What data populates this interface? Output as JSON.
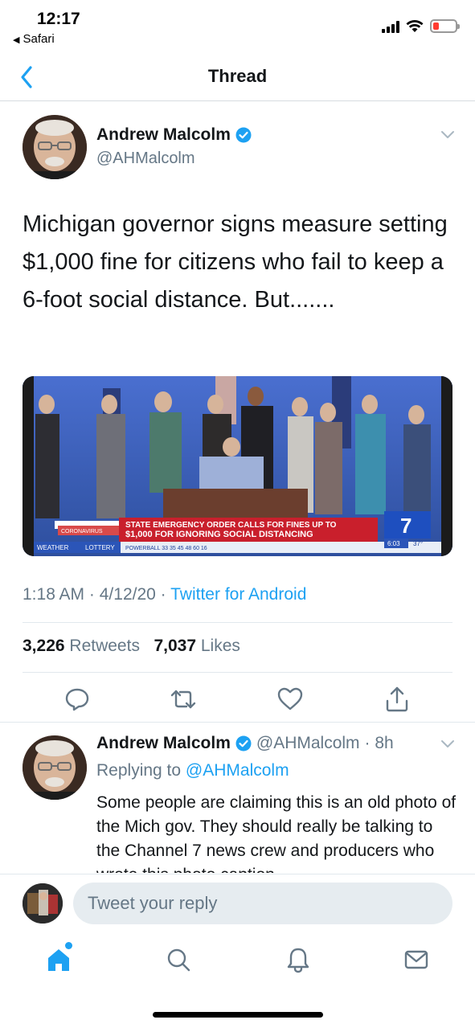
{
  "status_bar": {
    "time": "12:17",
    "back_app": "Safari"
  },
  "nav": {
    "title": "Thread",
    "back_icon": "chevron-left-icon"
  },
  "main_tweet": {
    "author_name": "Andrew Malcolm",
    "author_handle": "@AHMalcolm",
    "verified": true,
    "text": "Michigan governor signs measure setting $1,000 fine for citizens who fail to keep a 6-foot social distance. But.......",
    "media": {
      "banner_top": "STATE EMERGENCY ORDER CALLS FOR FINES UP TO",
      "banner_bottom": "$1,000 FOR IGNORING SOCIAL DISTANCING",
      "tag_left": "CORONAVIRUS",
      "ticker_weather": "WEATHER",
      "ticker_lottery": "LOTTERY",
      "ticker_powerball": "POWERBALL  33  35  45  48  60  16",
      "channel": "7",
      "clock": "6:03",
      "temp": "37°"
    },
    "time": "1:18 AM",
    "date": "4/12/20",
    "separator": "·",
    "source": "Twitter for Android",
    "retweets_count": "3,226",
    "retweets_label": "Retweets",
    "likes_count": "7,037",
    "likes_label": "Likes"
  },
  "reply_tweet": {
    "author_name": "Andrew Malcolm",
    "author_handle": "@AHMalcolm",
    "age": "· 8h",
    "replying_prefix": "Replying to",
    "replying_to": "@AHMalcolm",
    "text": "Some people are claiming this is an old photo of the Mich gov. They should really be talking to the Channel 7 news crew and producers who wrote this photo caption."
  },
  "composer": {
    "placeholder": "Tweet your reply"
  },
  "colors": {
    "accent": "#1da1f2",
    "secondary_text": "#657786",
    "primary_text": "#14171a"
  }
}
